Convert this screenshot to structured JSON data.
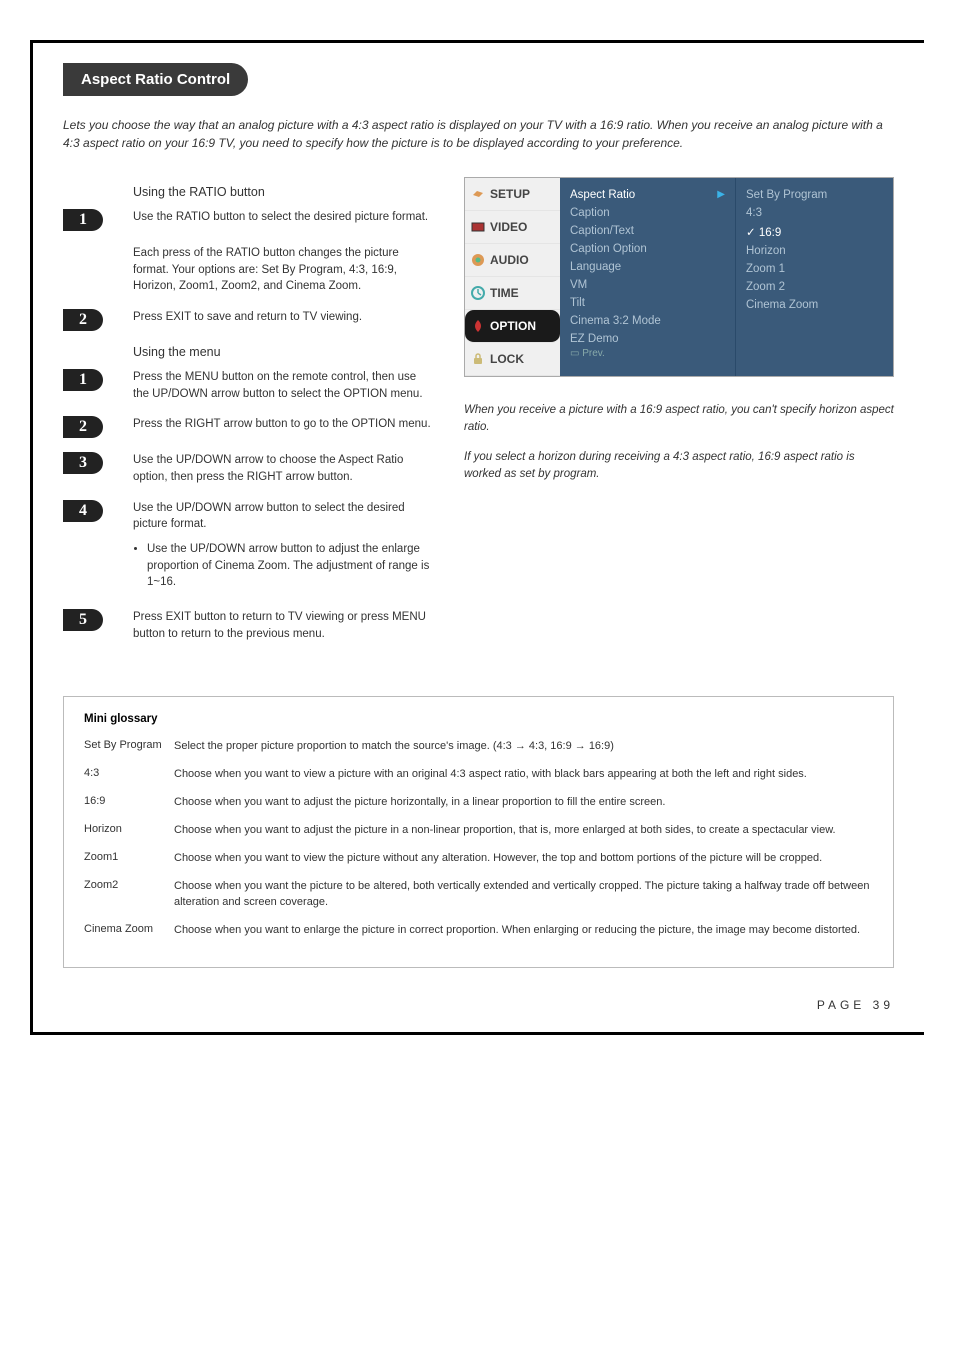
{
  "header": {
    "title": "Aspect Ratio Control"
  },
  "intro": "Lets you choose the way that an analog picture with a 4:3 aspect ratio is displayed on your TV with a 16:9 ratio. When you receive an analog picture with a 4:3 aspect ratio on your 16:9 TV, you need to specify how the picture is to be displayed according to your preference.",
  "ratio_section": {
    "heading": "Using the RATIO button",
    "step1": "Use the RATIO button to select the desired picture format.",
    "note": "Each press of the RATIO button changes the picture format. Your options are: Set By Program, 4:3, 16:9, Horizon, Zoom1, Zoom2, and Cinema Zoom.",
    "step2": "Press EXIT to save and return to TV viewing."
  },
  "menu_section": {
    "heading": "Using the menu",
    "step1": "Press the MENU button on the remote control, then use the UP/DOWN arrow button to select the OPTION menu.",
    "step2": "Press the RIGHT arrow button to go to the OPTION menu.",
    "step3": "Use the UP/DOWN arrow to choose the Aspect Ratio option, then press the RIGHT arrow button.",
    "step4": "Use the UP/DOWN arrow button to select the desired picture format.",
    "step4_bullet": "Use the UP/DOWN arrow button to adjust the enlarge proportion of Cinema Zoom. The adjustment of range is 1~16.",
    "step5": "Press EXIT button to return to TV viewing or press MENU button to return to the previous menu."
  },
  "osd": {
    "tabs": [
      "SETUP",
      "VIDEO",
      "AUDIO",
      "TIME",
      "OPTION",
      "LOCK"
    ],
    "menu_items": [
      "Aspect Ratio",
      "Caption",
      "Caption/Text",
      "Caption Option",
      "Language",
      "VM",
      "Tilt",
      "Cinema 3:2 Mode",
      "EZ Demo"
    ],
    "prev": "Prev.",
    "submenu": [
      "Set By Program",
      "4:3",
      "16:9",
      "Horizon",
      "Zoom 1",
      "Zoom 2",
      "Cinema Zoom"
    ]
  },
  "notes": {
    "n1": "When you receive a picture with a 16:9 aspect ratio, you can't specify horizon aspect ratio.",
    "n2": "If you select a horizon during receiving a 4:3 aspect ratio, 16:9 aspect ratio is worked as set by program."
  },
  "glossary": {
    "title": "Mini glossary",
    "items": [
      {
        "term": "Set By Program",
        "def": "Select the proper picture proportion to match the source's image.  (4:3 → 4:3, 16:9 → 16:9)"
      },
      {
        "term": "4:3",
        "def": "Choose when you want to view a picture with an original 4:3 aspect ratio, with black bars appearing at both the left and right sides."
      },
      {
        "term": "16:9",
        "def": "Choose when you want to adjust the picture horizontally, in a linear proportion to fill the entire screen."
      },
      {
        "term": "Horizon",
        "def": "Choose when you want to adjust the picture in a non-linear proportion, that is, more enlarged at both sides, to create a spectacular view."
      },
      {
        "term": "Zoom1",
        "def": "Choose when you want to view the picture without any alteration. However, the top and bottom portions of the picture will be cropped."
      },
      {
        "term": "Zoom2",
        "def": "Choose when you want the picture to be altered, both vertically extended and vertically cropped. The picture taking a halfway trade off between alteration and screen coverage."
      },
      {
        "term": "Cinema Zoom",
        "def": "Choose when you want to enlarge the picture in correct proportion. When enlarging or reducing the picture, the image may become distorted."
      }
    ]
  },
  "page": "PAGE 39"
}
